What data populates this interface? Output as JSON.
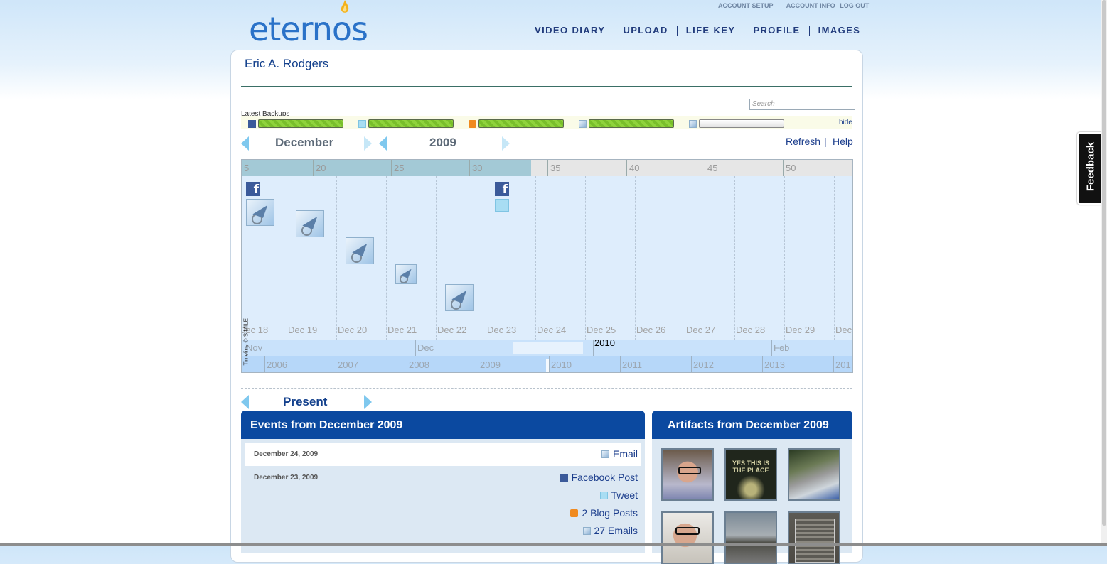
{
  "brand": {
    "logo_text": "eternos"
  },
  "top_links": [
    "ACCOUNT SETUP",
    "ACCOUNT INFO",
    "LOG OUT"
  ],
  "nav": [
    "VIDEO DIARY",
    "UPLOAD",
    "LIFE KEY",
    "PROFILE",
    "IMAGES"
  ],
  "user": {
    "name": "Eric A. Rodgers"
  },
  "search": {
    "placeholder": "Search"
  },
  "backups": {
    "label": "Latest Backups",
    "hide": "hide",
    "items": [
      {
        "source": "facebook-icon",
        "progress": 1.0
      },
      {
        "source": "twitter-icon",
        "progress": 1.0
      },
      {
        "source": "rss-icon",
        "progress": 1.0
      },
      {
        "source": "email-icon",
        "progress": 1.0
      },
      {
        "source": "email-icon",
        "progress": 0.0
      }
    ]
  },
  "selector": {
    "month": "December",
    "year": "2009",
    "refresh": "Refresh",
    "sep": "|",
    "help": "Help"
  },
  "timeline": {
    "week_ticks": [
      "5",
      "20",
      "25",
      "30",
      "35",
      "40",
      "45",
      "50"
    ],
    "days": [
      "Dec 18",
      "Dec 19",
      "Dec 20",
      "Dec 21",
      "Dec 22",
      "Dec 23",
      "Dec 24",
      "Dec 25",
      "Dec 26",
      "Dec 27",
      "Dec 28",
      "Dec 29",
      "Dec"
    ],
    "months": [
      "Nov",
      "Dec",
      "Feb"
    ],
    "year_marker": "2010",
    "years": [
      "2006",
      "2007",
      "2008",
      "2009",
      "2010",
      "2011",
      "2012",
      "2013",
      "201"
    ],
    "credit": "Timeline © SIMILE"
  },
  "present": {
    "label": "Present"
  },
  "events": {
    "title": "Events from December 2009",
    "groups": [
      {
        "date": "December 24, 2009",
        "items": [
          {
            "icon": "email-icon",
            "label": "Email"
          }
        ]
      },
      {
        "date": "December 23, 2009",
        "items": [
          {
            "icon": "facebook-icon",
            "label": "Facebook Post"
          },
          {
            "icon": "twitter-icon",
            "label": "Tweet"
          },
          {
            "icon": "rss-icon",
            "label": "2 Blog Posts"
          },
          {
            "icon": "email-icon",
            "label": "27 Emails"
          }
        ]
      }
    ]
  },
  "artifacts": {
    "title": "Artifacts from December 2009",
    "thumb2_text": "YES THIS IS THE PLACE"
  },
  "feedback": {
    "label": "Feedback"
  }
}
